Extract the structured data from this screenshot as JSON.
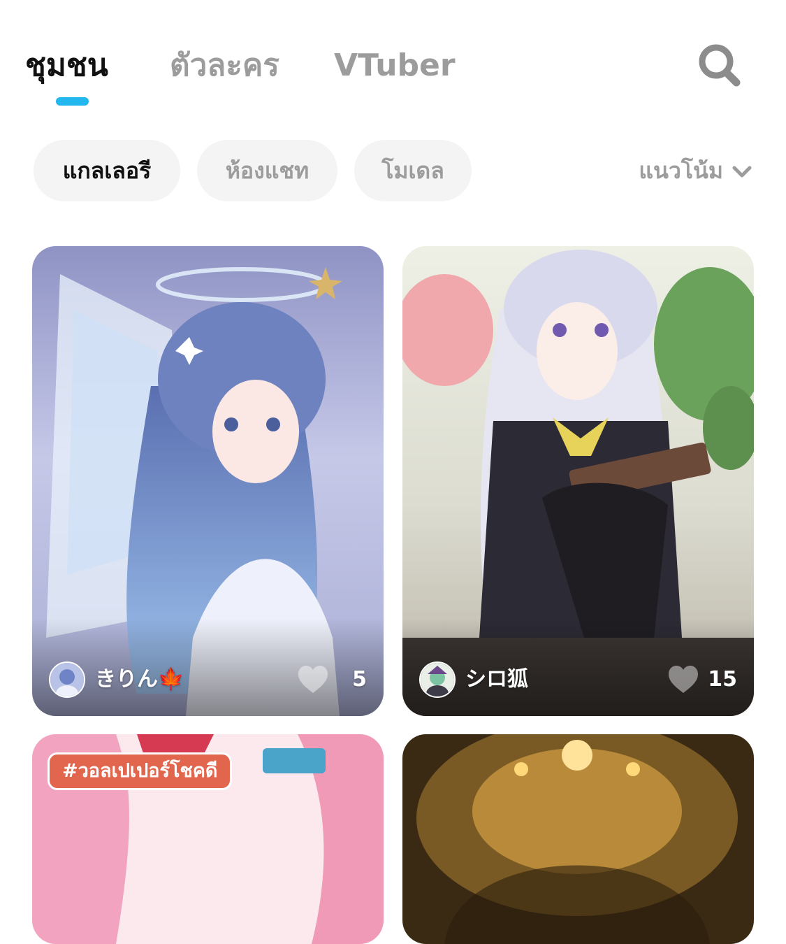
{
  "tabs": [
    {
      "label": "ชุมชน",
      "active": true
    },
    {
      "label": "ตัวละคร",
      "active": false
    },
    {
      "label": "VTuber",
      "active": false
    }
  ],
  "search": {
    "icon": "search-icon"
  },
  "filters": [
    {
      "label": "แกลเลอรี",
      "active": true
    },
    {
      "label": "ห้องแชท",
      "active": false
    },
    {
      "label": "โมเดล",
      "active": false
    }
  ],
  "sort": {
    "label": "แนวโน้ม",
    "icon": "chevron-down-icon"
  },
  "colors": {
    "accent": "#22b7ee",
    "tag": "#e2664d",
    "inactive_text": "#9c9c9c"
  },
  "feed": [
    {
      "author": "きりん",
      "author_emoji": "🍁",
      "likes": "5",
      "avatar_icon": "user-avatar"
    },
    {
      "author": "シロ狐",
      "likes": "15",
      "avatar_icon": "user-avatar"
    },
    {
      "tag": "#วอลเปเปอร์โชคดี"
    },
    {}
  ]
}
